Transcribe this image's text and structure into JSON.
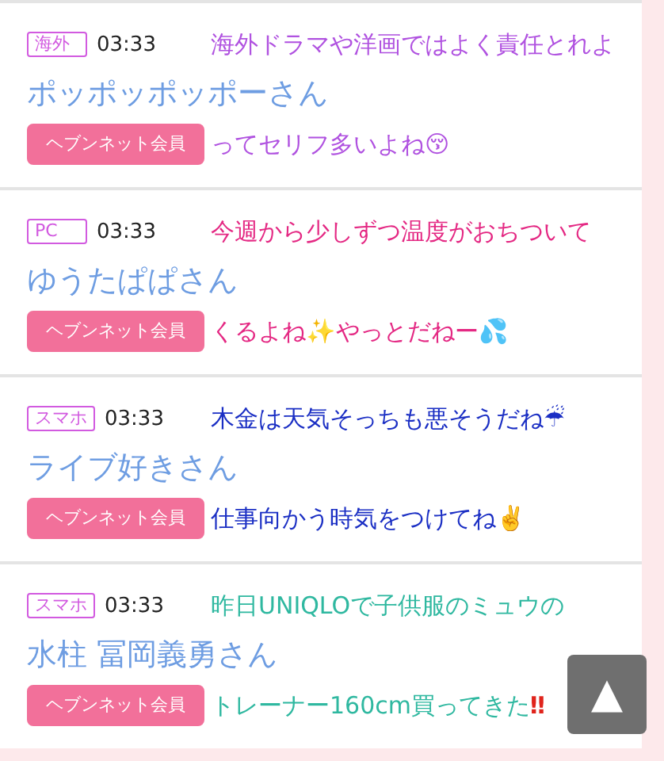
{
  "posts": [
    {
      "tag": "海外",
      "time": "03:33",
      "user": "ポッポッポッポーさん",
      "badge": "ヘブンネット会員",
      "color": "#b052e0",
      "caption": [
        "海外ドラマや洋画ではよく責任とれよ",
        "ってセリフ多いよね😚"
      ]
    },
    {
      "tag": "PC",
      "time": "03:33",
      "user": "ゆうたぱぱさん",
      "badge": "ヘブンネット会員",
      "color": "#e42883",
      "caption": [
        "今週から少しずつ温度がおちついて",
        "くるよね✨やっとだねー💦"
      ]
    },
    {
      "tag": "スマホ",
      "time": "03:33",
      "user": "ライブ好きさん",
      "badge": "ヘブンネット会員",
      "color": "#1b2fc4",
      "caption": [
        "木金は天気そっちも悪そうだね☔",
        "仕事向かう時気をつけてね✌️"
      ]
    },
    {
      "tag": "スマホ",
      "time": "03:33",
      "user": "水柱 冨岡義勇さん",
      "badge": "ヘブンネット会員",
      "color": "#2fb8a0",
      "caption": [
        "昨日UNIQLOで子供服のミュウの",
        "トレーナー160cm買ってきた**‼**"
      ]
    }
  ],
  "scroll_top": {
    "icon": "▲"
  }
}
